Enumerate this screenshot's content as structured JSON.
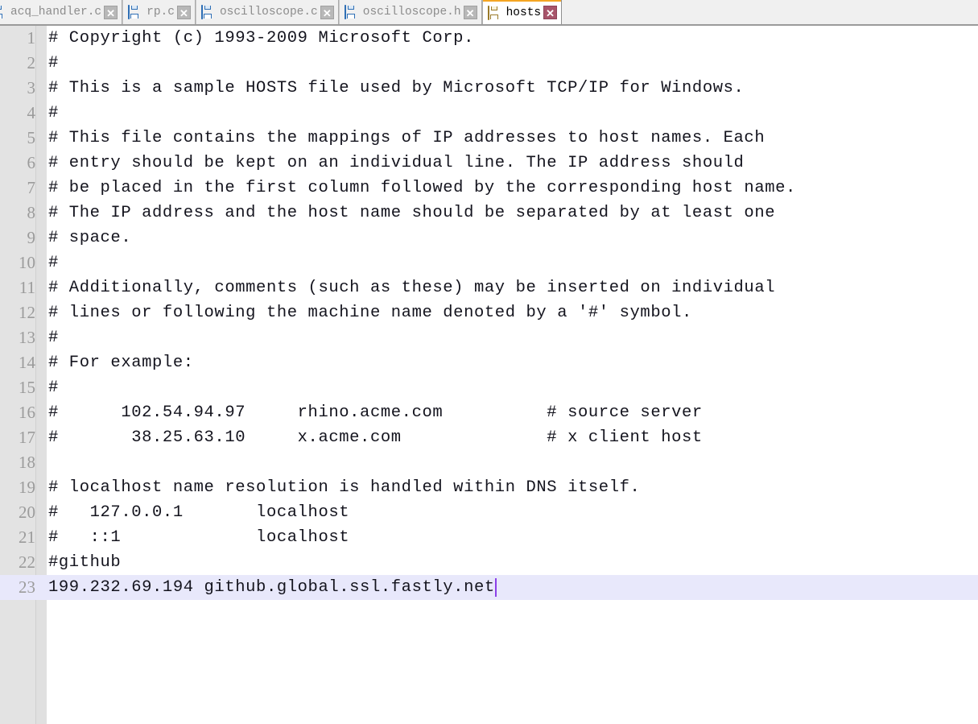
{
  "window": {
    "title": "hosts",
    "accent_active_tab": "#f5a623",
    "current_line_highlight": "#e8e8fb",
    "caret_color": "#8b3fe8",
    "gutter_color": "#e3e3e3",
    "tabbar_background": "#f0f0f0"
  },
  "tabs": [
    {
      "label": "acq_handler.c",
      "icon": "floppy-disk-icon",
      "close_label": "✕",
      "active": false,
      "clipped": true
    },
    {
      "label": "rp.c",
      "icon": "floppy-disk-icon",
      "close_label": "✕",
      "active": false,
      "clipped": false
    },
    {
      "label": "oscilloscope.c",
      "icon": "floppy-disk-icon",
      "close_label": "✕",
      "active": false,
      "clipped": false
    },
    {
      "label": "oscilloscope.h",
      "icon": "floppy-disk-icon",
      "close_label": "✕",
      "active": false,
      "clipped": false
    },
    {
      "label": "hosts",
      "icon": "floppy-disk-icon",
      "close_label": "✕",
      "active": true,
      "clipped": false
    }
  ],
  "editor": {
    "current_line": 23,
    "caret_at_end_of_line": 23,
    "lines": [
      {
        "n": "1",
        "text": "# Copyright (c) 1993-2009 Microsoft Corp."
      },
      {
        "n": "2",
        "text": "#"
      },
      {
        "n": "3",
        "text": "# This is a sample HOSTS file used by Microsoft TCP/IP for Windows."
      },
      {
        "n": "4",
        "text": "#"
      },
      {
        "n": "5",
        "text": "# This file contains the mappings of IP addresses to host names. Each"
      },
      {
        "n": "6",
        "text": "# entry should be kept on an individual line. The IP address should"
      },
      {
        "n": "7",
        "text": "# be placed in the first column followed by the corresponding host name."
      },
      {
        "n": "8",
        "text": "# The IP address and the host name should be separated by at least one"
      },
      {
        "n": "9",
        "text": "# space."
      },
      {
        "n": "10",
        "text": "#"
      },
      {
        "n": "11",
        "text": "# Additionally, comments (such as these) may be inserted on individual"
      },
      {
        "n": "12",
        "text": "# lines or following the machine name denoted by a '#' symbol."
      },
      {
        "n": "13",
        "text": "#"
      },
      {
        "n": "14",
        "text": "# For example:"
      },
      {
        "n": "15",
        "text": "#"
      },
      {
        "n": "16",
        "text": "#      102.54.94.97     rhino.acme.com          # source server"
      },
      {
        "n": "17",
        "text": "#       38.25.63.10     x.acme.com              # x client host"
      },
      {
        "n": "18",
        "text": ""
      },
      {
        "n": "19",
        "text": "# localhost name resolution is handled within DNS itself."
      },
      {
        "n": "20",
        "text": "#   127.0.0.1       localhost"
      },
      {
        "n": "21",
        "text": "#   ::1             localhost"
      },
      {
        "n": "22",
        "text": "#github"
      },
      {
        "n": "23",
        "text": "199.232.69.194 github.global.ssl.fastly.net"
      }
    ]
  }
}
